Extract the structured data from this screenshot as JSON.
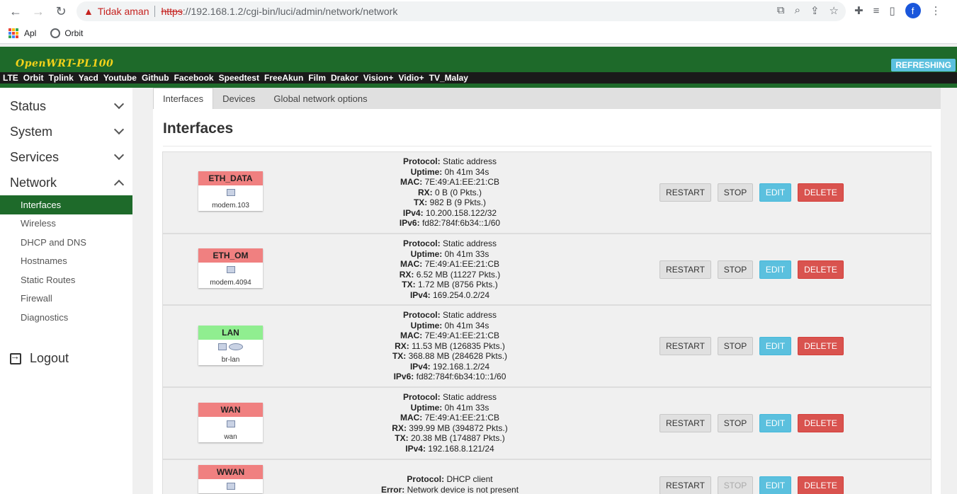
{
  "browser": {
    "security_label": "Tidak aman",
    "url_protocol": "https",
    "url_rest": "://192.168.1.2/cgi-bin/luci/admin/network/network",
    "profile_initial": "f",
    "bookmarks": [
      {
        "label": "Apl",
        "icon": "apps-grid-icon"
      },
      {
        "label": "Orbit",
        "icon": "globe-icon"
      }
    ]
  },
  "header": {
    "brand": "OpenWRT-PL100",
    "status_badge": "REFRESHING",
    "menu": [
      "LTE",
      "Orbit",
      "Tplink",
      "Yacd",
      "Youtube",
      "Github",
      "Facebook",
      "Speedtest",
      "FreeAkun",
      "Film",
      "Drakor",
      "Vision+",
      "Vidio+",
      "TV_Malay"
    ]
  },
  "sidebar": {
    "categories": [
      {
        "label": "Status"
      },
      {
        "label": "System"
      },
      {
        "label": "Services"
      },
      {
        "label": "Network"
      }
    ],
    "network_items": [
      "Interfaces",
      "Wireless",
      "DHCP and DNS",
      "Hostnames",
      "Static Routes",
      "Firewall",
      "Diagnostics"
    ],
    "logout": "Logout"
  },
  "main": {
    "tabs": [
      "Interfaces",
      "Devices",
      "Global network options"
    ],
    "title": "Interfaces",
    "buttons": {
      "restart": "RESTART",
      "stop": "STOP",
      "edit": "EDIT",
      "delete": "DELETE"
    },
    "colors": {
      "red": "#f08080",
      "green": "#90ee90"
    },
    "interfaces": [
      {
        "name": "ETH_DATA",
        "color": "#f08080",
        "device": "modem.103",
        "fields": [
          [
            "Protocol:",
            "Static address"
          ],
          [
            "Uptime:",
            "0h 41m 34s"
          ],
          [
            "MAC:",
            "7E:49:A1:EE:21:CB"
          ],
          [
            "RX:",
            "0 B (0 Pkts.)"
          ],
          [
            "TX:",
            "982 B (9 Pkts.)"
          ],
          [
            "IPv4:",
            "10.200.158.122/32"
          ],
          [
            "IPv6:",
            "fd82:784f:6b34::1/60"
          ]
        ]
      },
      {
        "name": "ETH_OM",
        "color": "#f08080",
        "device": "modem.4094",
        "fields": [
          [
            "Protocol:",
            "Static address"
          ],
          [
            "Uptime:",
            "0h 41m 33s"
          ],
          [
            "MAC:",
            "7E:49:A1:EE:21:CB"
          ],
          [
            "RX:",
            "6.52 MB (11227 Pkts.)"
          ],
          [
            "TX:",
            "1.72 MB (8756 Pkts.)"
          ],
          [
            "IPv4:",
            "169.254.0.2/24"
          ]
        ]
      },
      {
        "name": "LAN",
        "color": "#90ee90",
        "device": "br-lan",
        "fields": [
          [
            "Protocol:",
            "Static address"
          ],
          [
            "Uptime:",
            "0h 41m 34s"
          ],
          [
            "MAC:",
            "7E:49:A1:EE:21:CB"
          ],
          [
            "RX:",
            "11.53 MB (126835 Pkts.)"
          ],
          [
            "TX:",
            "368.88 MB (284628 Pkts.)"
          ],
          [
            "IPv4:",
            "192.168.1.2/24"
          ],
          [
            "IPv6:",
            "fd82:784f:6b34:10::1/60"
          ]
        ]
      },
      {
        "name": "WAN",
        "color": "#f08080",
        "device": "wan",
        "fields": [
          [
            "Protocol:",
            "Static address"
          ],
          [
            "Uptime:",
            "0h 41m 33s"
          ],
          [
            "MAC:",
            "7E:49:A1:EE:21:CB"
          ],
          [
            "RX:",
            "399.99 MB (394872 Pkts.)"
          ],
          [
            "TX:",
            "20.38 MB (174887 Pkts.)"
          ],
          [
            "IPv4:",
            "192.168.8.121/24"
          ]
        ]
      },
      {
        "name": "WWAN",
        "color": "#f08080",
        "device": "",
        "fields": [
          [
            "Protocol:",
            "DHCP client"
          ],
          [
            "Error:",
            "Network device is not present"
          ]
        ]
      }
    ]
  }
}
